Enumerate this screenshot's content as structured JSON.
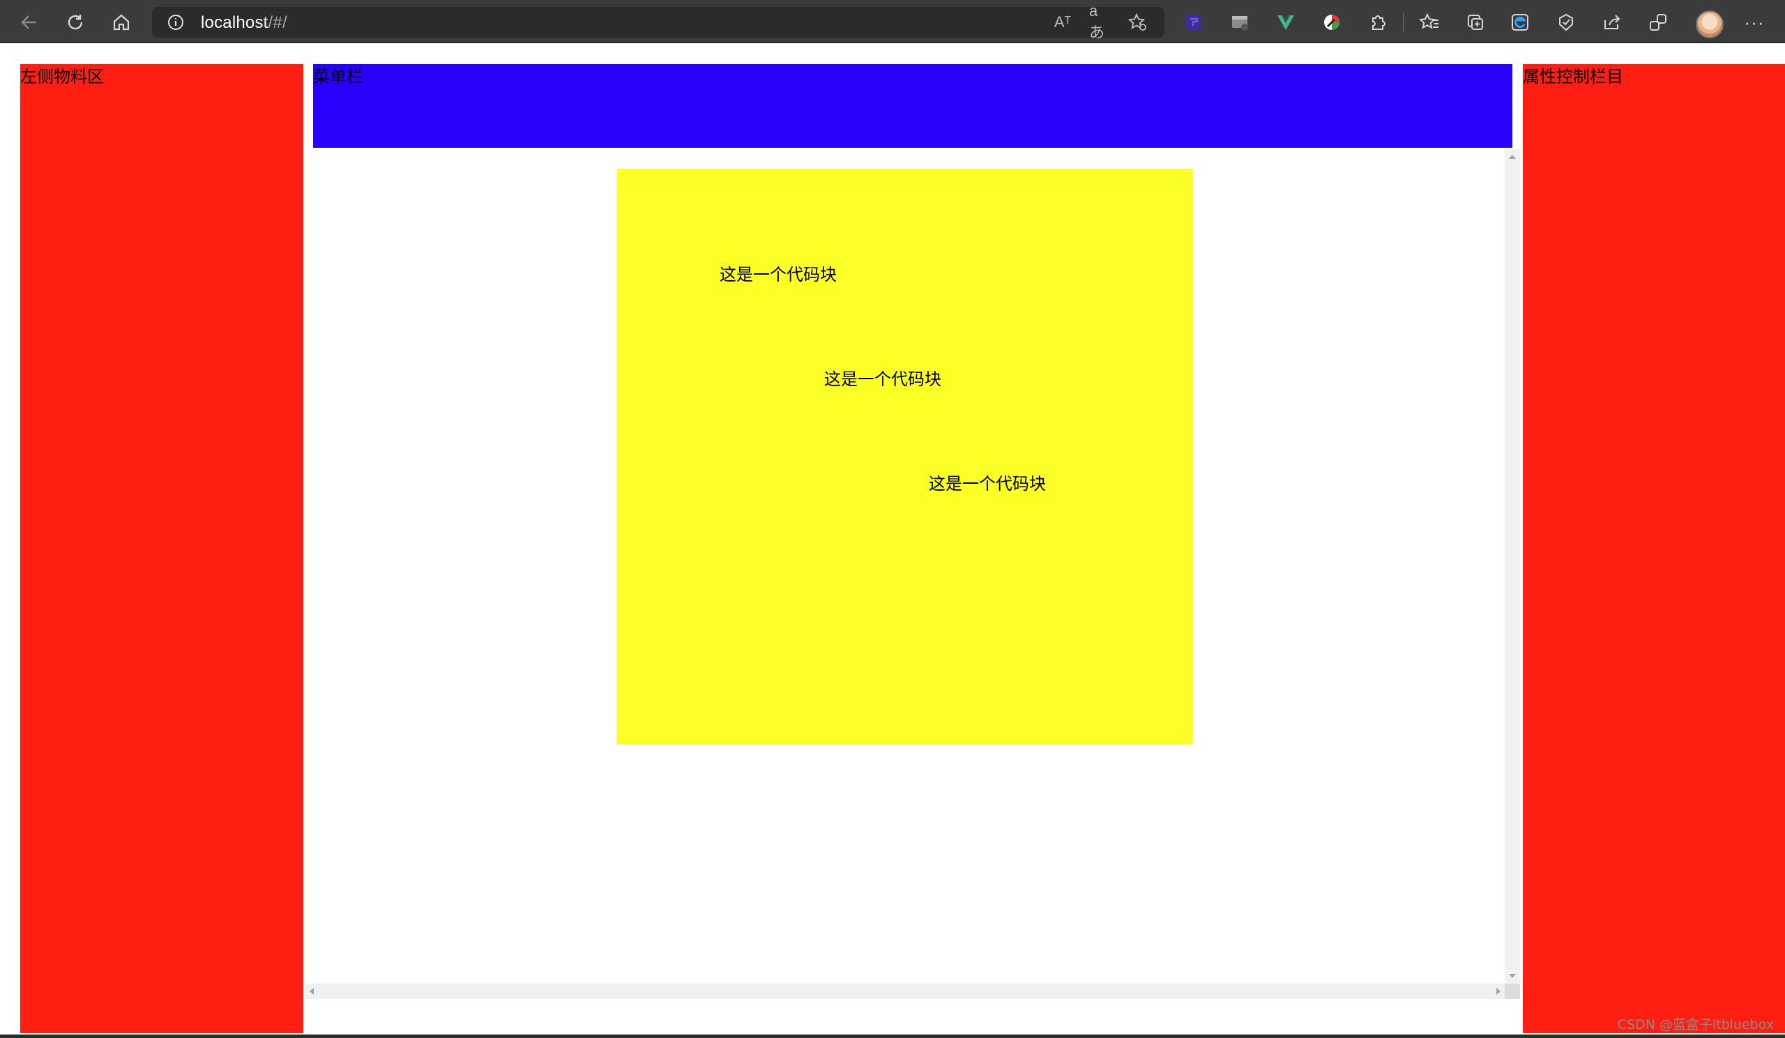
{
  "browser": {
    "url_host": "localhost",
    "url_path": "/#/",
    "read_aloud_label": "Aᵀ",
    "translate_label": "aあ",
    "menu_label": "···"
  },
  "colors": {
    "panel_red": "#ff1e12",
    "menu_blue": "#2a00ff",
    "block_yellow": "#fbff26",
    "toolbar_bg": "#3b3b3b"
  },
  "left_panel": {
    "label": "左侧物料区"
  },
  "menu_bar": {
    "label": "菜单栏"
  },
  "right_panel": {
    "label": "属性控制栏目"
  },
  "canvas": {
    "code_blocks": [
      {
        "text": "这是一个代码块"
      },
      {
        "text": "这是一个代码块"
      },
      {
        "text": "这是一个代码块"
      }
    ]
  },
  "watermark": "CSDN @蓝盒子itbluebox",
  "icons": [
    "back-icon",
    "refresh-icon",
    "home-icon",
    "info-icon",
    "read-aloud-icon",
    "translate-icon",
    "favorite-add-icon",
    "extension-icons",
    "favorites-icon",
    "collections-icon",
    "share-icon",
    "profile-avatar",
    "more-icon"
  ]
}
